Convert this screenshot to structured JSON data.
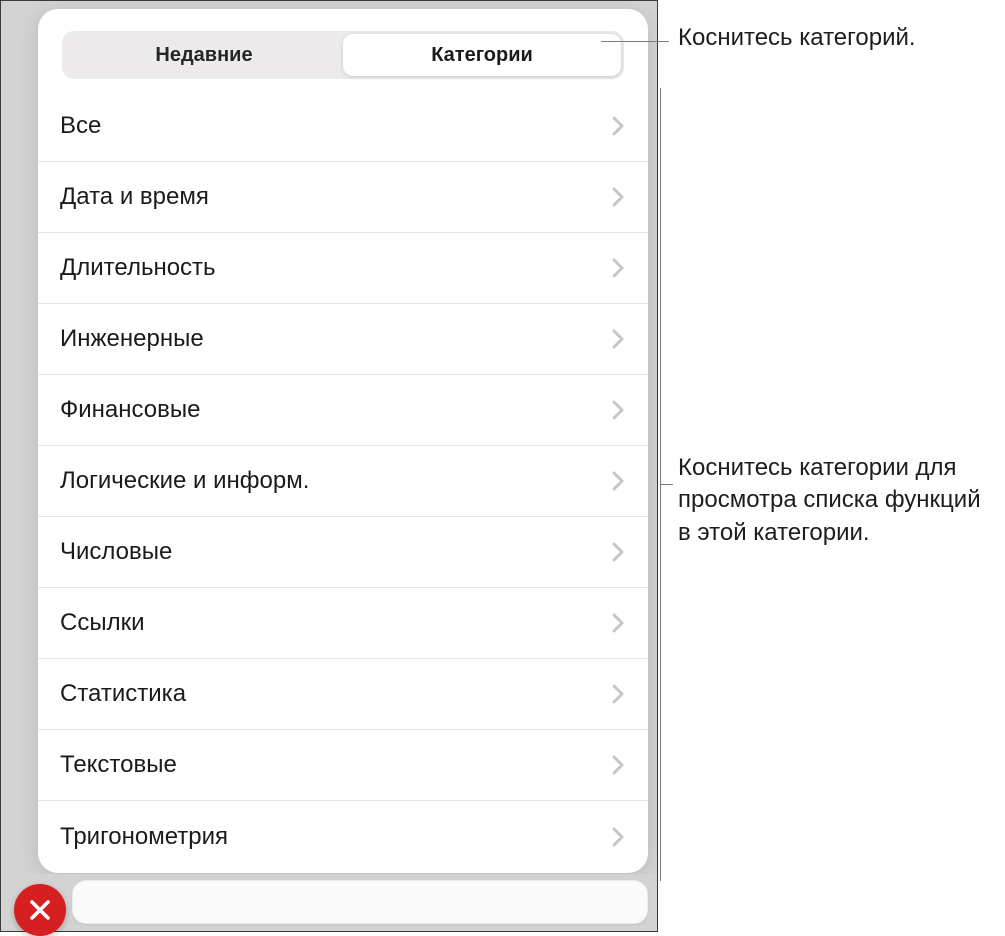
{
  "segmented": {
    "recent_label": "Недавние",
    "categories_label": "Категории"
  },
  "categories": [
    {
      "label": "Все"
    },
    {
      "label": "Дата и время"
    },
    {
      "label": "Длительность"
    },
    {
      "label": "Инженерные"
    },
    {
      "label": "Финансовые"
    },
    {
      "label": "Логические и информ."
    },
    {
      "label": "Числовые"
    },
    {
      "label": "Ссылки"
    },
    {
      "label": "Статистика"
    },
    {
      "label": "Текстовые"
    },
    {
      "label": "Тригонометрия"
    }
  ],
  "callouts": {
    "tap_categories": "Коснитесь категорий.",
    "tap_category_list": "Коснитесь категории для просмотра списка функций в этой категории."
  }
}
